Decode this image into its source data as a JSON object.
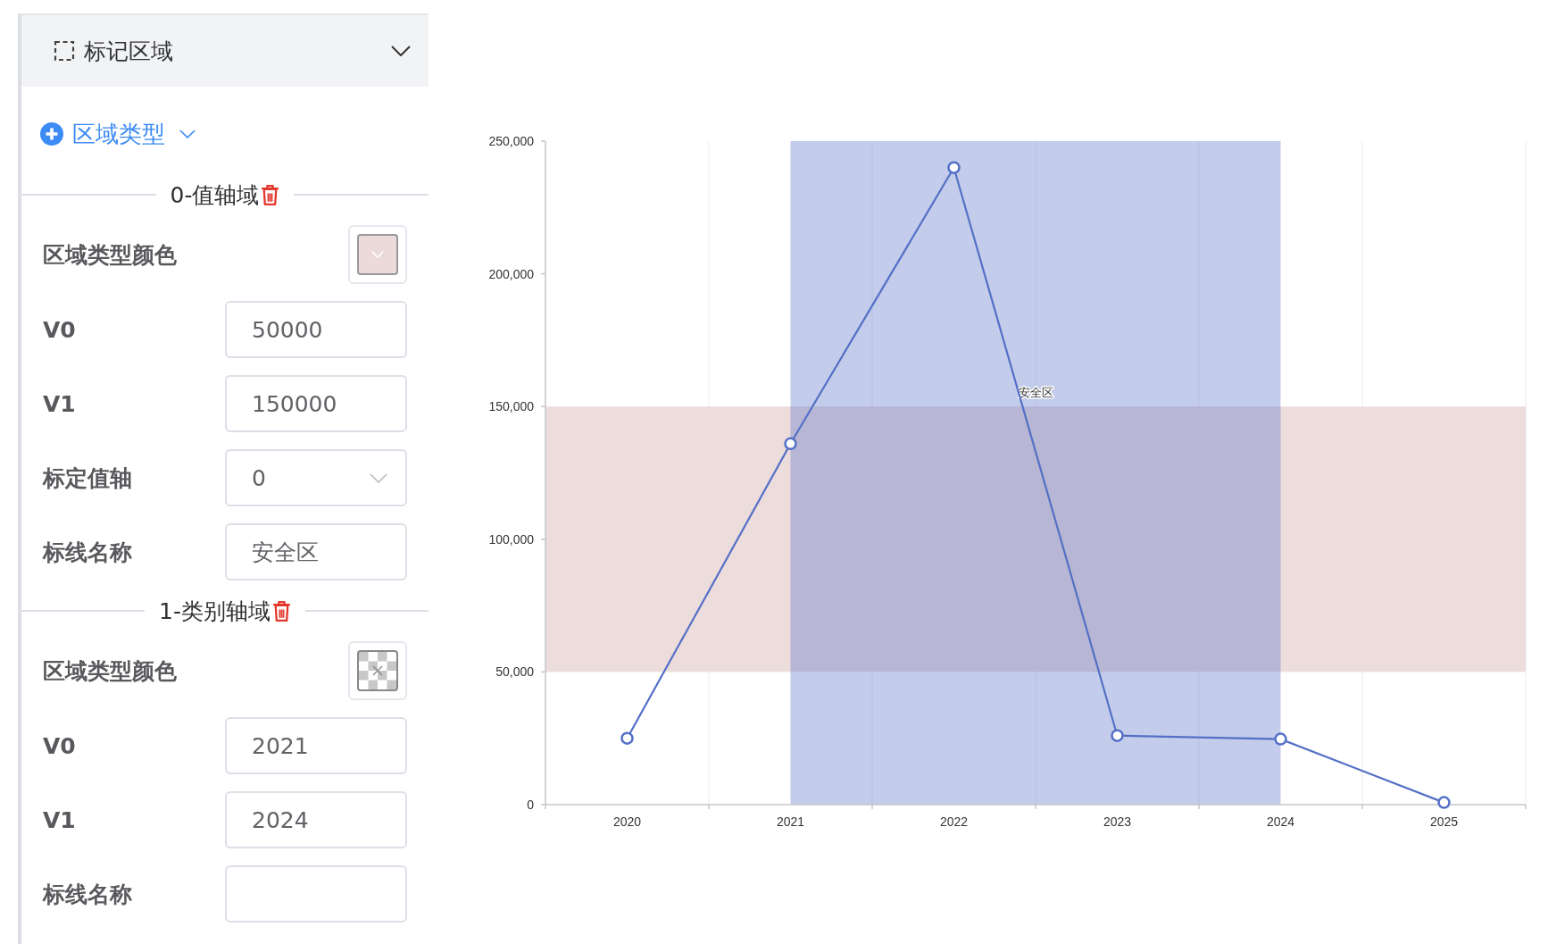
{
  "panel": {
    "header": {
      "title": "标记区域"
    },
    "add_menu": {
      "label": "区域类型"
    },
    "regions": [
      {
        "title": "0-值轴域",
        "rows": [
          {
            "kind": "swatch",
            "label": "区域类型颜色",
            "color": "#ecdada"
          },
          {
            "kind": "input",
            "label": "V0",
            "value": "50000"
          },
          {
            "kind": "input",
            "label": "V1",
            "value": "150000"
          },
          {
            "kind": "select",
            "label": "标定值轴",
            "value": "0"
          },
          {
            "kind": "input",
            "label": "标线名称",
            "value": "安全区"
          }
        ]
      },
      {
        "title": "1-类别轴域",
        "rows": [
          {
            "kind": "empty_swatch",
            "label": "区域类型颜色"
          },
          {
            "kind": "input",
            "label": "V0",
            "value": "2021"
          },
          {
            "kind": "input",
            "label": "V1",
            "value": "2024"
          },
          {
            "kind": "input",
            "label": "标线名称"
          }
        ]
      }
    ]
  },
  "chart": {
    "chart_data": {
      "type": "line",
      "categories": [
        "2020",
        "2021",
        "2022",
        "2023",
        "2024",
        "2025"
      ],
      "series": [
        {
          "color": "#5470c6",
          "marker": "circle",
          "values": [
            25000,
            136000,
            240000,
            26000,
            24700,
            800
          ]
        }
      ],
      "ylim": [
        0,
        250000
      ],
      "yticks": [
        {
          "value": 0,
          "label": "0"
        },
        {
          "value": 50000,
          "label": "50,000"
        },
        {
          "value": 100000,
          "label": "100,000"
        },
        {
          "value": 150000,
          "label": "150,000"
        },
        {
          "value": 200000,
          "label": "200,000"
        },
        {
          "value": 250000,
          "label": "250,000"
        }
      ],
      "bands": [
        {
          "axis": "y",
          "from": 50000,
          "to": 150000,
          "label": "安全区",
          "color": "#eddcdc"
        },
        {
          "axis": "x",
          "from": "2021",
          "to": "2024",
          "color": "#5470c6"
        }
      ]
    }
  }
}
